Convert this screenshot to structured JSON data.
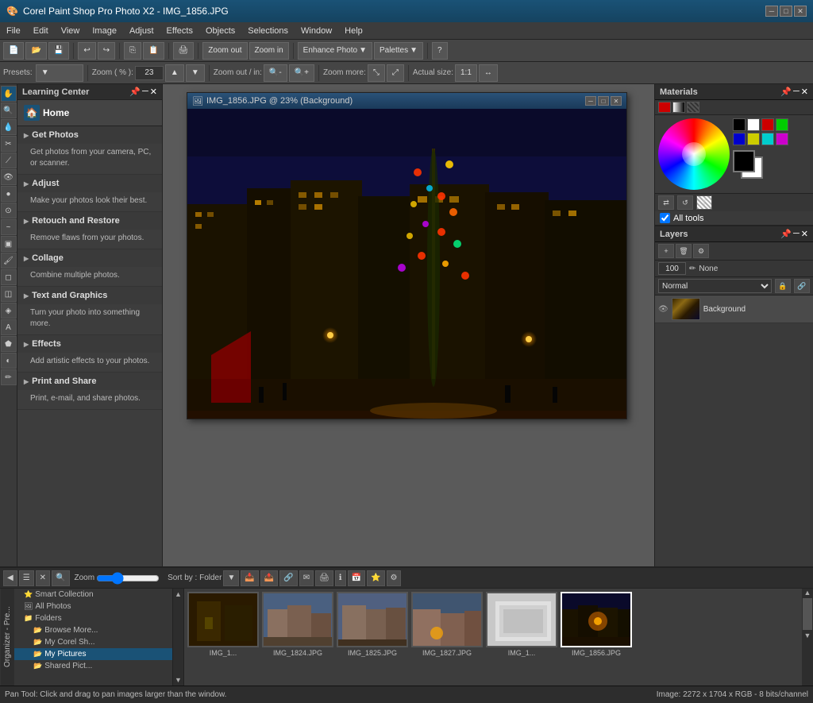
{
  "app": {
    "title": "Corel Paint Shop Pro Photo X2 - IMG_1856.JPG",
    "icon": "🎨"
  },
  "title_bar": {
    "title": "Corel Paint Shop Pro Photo X2 - IMG_1856.JPG",
    "minimize": "─",
    "maximize": "□",
    "close": "✕"
  },
  "menu": {
    "items": [
      "File",
      "Edit",
      "View",
      "Image",
      "Adjust",
      "Effects",
      "Objects",
      "Selections",
      "Window",
      "Help"
    ]
  },
  "toolbar": {
    "presets_label": "Presets:",
    "zoom_label": "Zoom ( % ):",
    "zoom_value": "23",
    "zoom_out_label": "Zoom out / in:",
    "zoom_more_label": "Zoom more:",
    "actual_size_label": "Actual size:",
    "zoom_out_btn": "Zoom out",
    "zoom_in_btn": "Zoom in",
    "enhance_photo_btn": "Enhance Photo",
    "palettes_btn": "Palettes"
  },
  "learning_center": {
    "title": "Learning Center",
    "home_label": "Home",
    "sections": [
      {
        "id": "get-photos",
        "label": "Get Photos",
        "body": "Get photos from your camera, PC, or scanner."
      },
      {
        "id": "adjust",
        "label": "Adjust",
        "body": "Make your photos look their best."
      },
      {
        "id": "retouch",
        "label": "Retouch and Restore",
        "body": "Remove flaws from your photos."
      },
      {
        "id": "collage",
        "label": "Collage",
        "body": "Combine multiple photos."
      },
      {
        "id": "text",
        "label": "Text and Graphics",
        "body": "Turn your photo into something more."
      },
      {
        "id": "effects",
        "label": "Effects",
        "body": "Add artistic effects to your photos."
      },
      {
        "id": "print",
        "label": "Print and Share",
        "body": "Print, e-mail, and share photos."
      }
    ]
  },
  "image_window": {
    "title": "IMG_1856.JPG @ 23% (Background)",
    "filename": "IMG_1856.JPG"
  },
  "materials": {
    "title": "Materials",
    "all_tools_label": "All tools",
    "fg_label": "Foreground",
    "bg_label": "Background"
  },
  "layers": {
    "title": "Layers",
    "opacity_value": "100",
    "blend_mode": "Normal",
    "none_label": "None",
    "layer_name": "Background"
  },
  "organizer": {
    "zoom_label": "Zoom",
    "sort_label": "Sort by : Folder",
    "tab_label": "Organizer - Pre...",
    "tree": [
      {
        "label": "Smart Collection",
        "level": 1
      },
      {
        "label": "All Photos",
        "level": 1
      },
      {
        "label": "Folders",
        "level": 1
      },
      {
        "label": "Browse More...",
        "level": 2
      },
      {
        "label": "My Corel Sh...",
        "level": 2
      },
      {
        "label": "My Pictures",
        "level": 2
      },
      {
        "label": "Shared Pict...",
        "level": 2
      }
    ],
    "thumbnails": [
      {
        "label": "IMG_1...",
        "filename": "IMG_1..."
      },
      {
        "label": "IMG_1824.JPG",
        "filename": "IMG_1824.JPG"
      },
      {
        "label": "IMG_1825.JPG",
        "filename": "IMG_1825.JPG"
      },
      {
        "label": "IMG_1827.JPG",
        "filename": "IMG_1827.JPG"
      },
      {
        "label": "IMG_1...",
        "filename": "IMG_1..."
      },
      {
        "label": "IMG_1856.JPG",
        "filename": "IMG_1856.JPG"
      }
    ]
  },
  "status_bar": {
    "pan_tool_msg": "Pan Tool: Click and drag to pan images larger than the window.",
    "image_info": "Image: 2272 x 1704 x RGB - 8 bits/channel"
  },
  "colors": {
    "accent": "#1a5276",
    "bg_dark": "#2d2d2d",
    "bg_mid": "#3a3a3a",
    "bg_light": "#4a4a4a",
    "border": "#222"
  }
}
